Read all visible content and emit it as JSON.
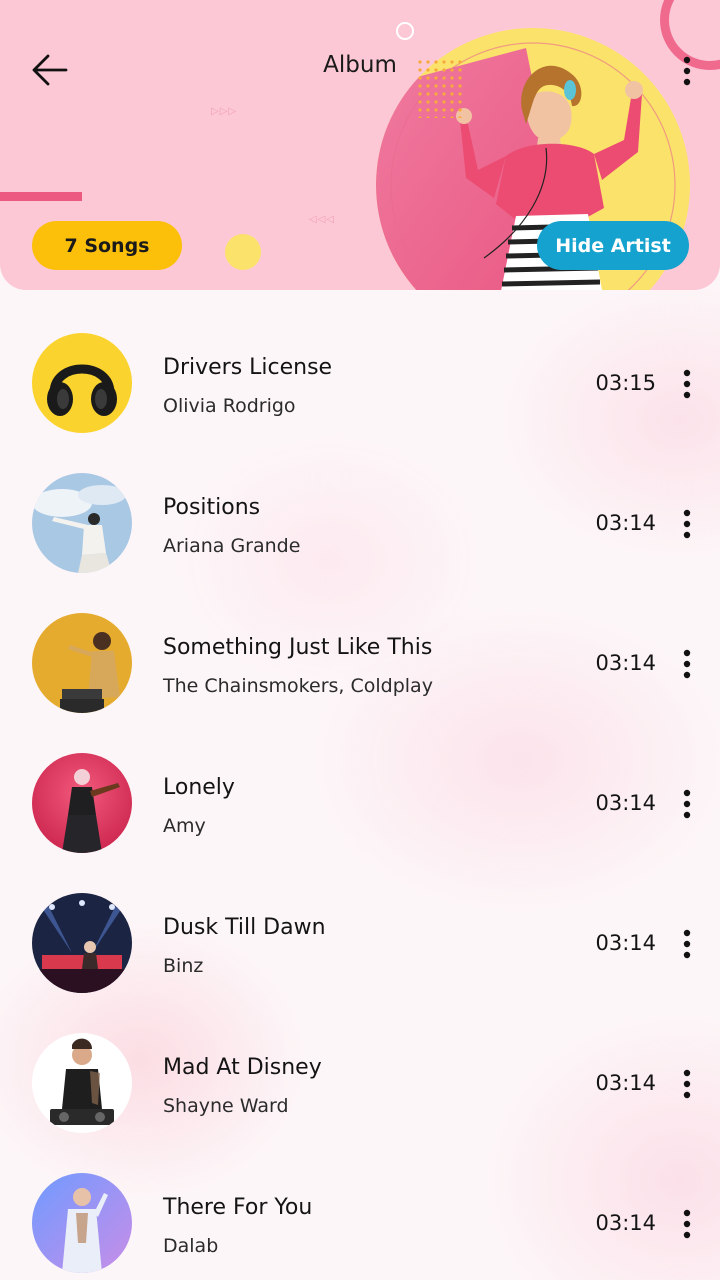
{
  "header": {
    "title": "Album",
    "songs_badge": "7 Songs",
    "hide_artist_label": "Hide Artist",
    "deco_arrows_right": "▷▷▷",
    "deco_arrows_left": "◁◁◁"
  },
  "colors": {
    "header_bg": "#fcc8d6",
    "songs_badge": "#fcc00a",
    "hide_artist": "#16a2cf",
    "accent_pink": "#ec5a82",
    "hero_yellow": "#fbe36b"
  },
  "icons": {
    "back": "arrow-left-icon",
    "menu": "more-vertical-icon"
  },
  "songs": [
    {
      "title": "Drivers License",
      "artist": "Olivia Rodrigo",
      "duration": "03:15",
      "thumb": "headphones"
    },
    {
      "title": "Positions",
      "artist": "Ariana Grande",
      "duration": "03:14",
      "thumb": "sky-dancer"
    },
    {
      "title": "Something Just Like This",
      "artist": "The Chainsmokers, Coldplay",
      "duration": "03:14",
      "thumb": "dj-mustard"
    },
    {
      "title": "Lonely",
      "artist": "Amy",
      "duration": "03:14",
      "thumb": "violinist-red"
    },
    {
      "title": "Dusk Till Dawn",
      "artist": "Binz",
      "duration": "03:14",
      "thumb": "concert-stage"
    },
    {
      "title": "Mad At Disney",
      "artist": "Shayne Ward",
      "duration": "03:14",
      "thumb": "dj-white"
    },
    {
      "title": "There For You",
      "artist": "Dalab",
      "duration": "03:14",
      "thumb": "singer-blue"
    }
  ]
}
